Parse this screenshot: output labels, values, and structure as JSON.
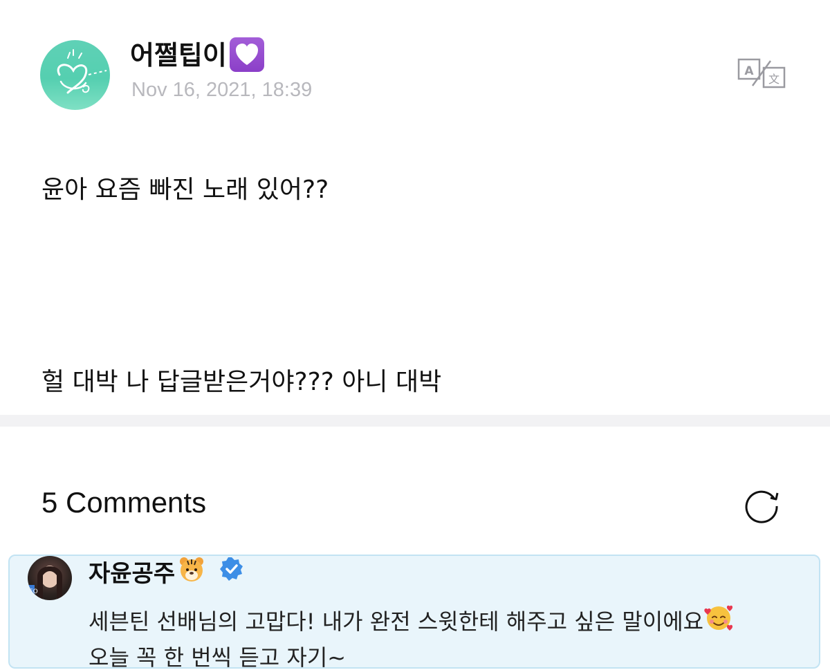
{
  "post": {
    "author_name": "어쩔팁이",
    "author_badge_icon": "purple-heart-icon",
    "date": "Nov 16, 2021, 18:39",
    "lines": [
      "윤아 요즘 빠진 노래 있어??",
      "헐 대박 나 답글받은거야??? 아니 대박"
    ],
    "translate_icon": "translate-icon"
  },
  "comments_section": {
    "title": "5 Comments",
    "refresh_icon": "refresh-icon"
  },
  "comment": {
    "name": "자윤공주",
    "name_icons": [
      "tiger-face-icon",
      "verified-badge-icon"
    ],
    "line1": "세븐틴 선배님의 고맙다! 내가 완전 스윗한테 해주고 싶은 말이에요",
    "line1_trailing_icon": "smiling-face-with-hearts-icon",
    "line2": "오늘 꼭 한 번씩 듣고 자기~"
  },
  "colors": {
    "accent_green": "#5fd1b6",
    "badge_purple": "#8b3fc8",
    "date_gray": "#b8b8bd",
    "divider_gray": "#f2f2f4",
    "comment_bg": "#e9f5fb",
    "comment_border": "#c2e3f3",
    "verified_blue": "#3d8ee6"
  }
}
